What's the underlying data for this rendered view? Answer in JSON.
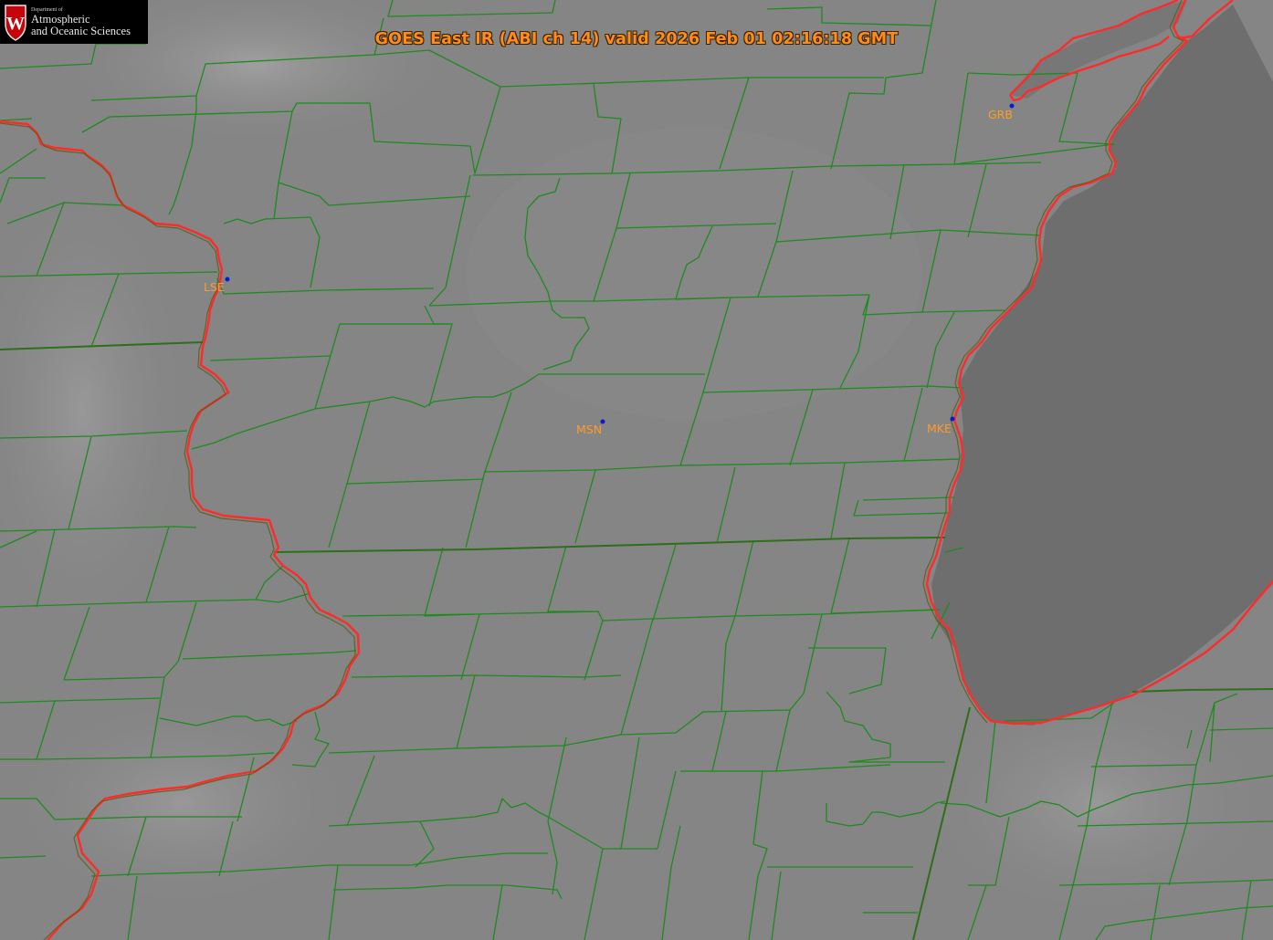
{
  "title": "GOES East IR (ABI ch 14) valid 2026 Feb 01 02:16:18 GMT",
  "logo": {
    "dept": "Department of",
    "line1": "Atmospheric",
    "line2": "and Oceanic Sciences",
    "mark": "W"
  },
  "colors": {
    "county_border": "#1f8a1f",
    "state_border": "#ff2a2a",
    "label": "#ff9a2a",
    "station": "#0a1bd6",
    "land": "#858585",
    "lake": "#6e6e6e"
  },
  "stations": [
    {
      "id": "LSE",
      "name": "LSE"
    },
    {
      "id": "MSN",
      "name": "MSN"
    },
    {
      "id": "MKE",
      "name": "MKE"
    },
    {
      "id": "GRB",
      "name": "GRB"
    }
  ]
}
